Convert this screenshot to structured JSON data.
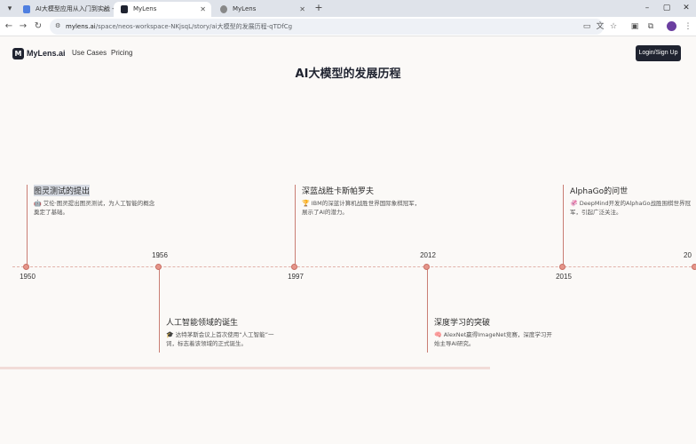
{
  "browser": {
    "tabs": [
      {
        "title": "AI大模型应用从入门到实战 - 飞...",
        "active": false
      },
      {
        "title": "MyLens",
        "active": true
      },
      {
        "title": "MyLens",
        "active": false
      }
    ],
    "url_host": "mylens.ai",
    "url_path": "/space/neos-workspace-NKjsqL/story/ai大模型的发展历程-qTDfCg"
  },
  "header": {
    "logo_text": "MyLens.ai",
    "logo_mark": "M",
    "nav": [
      "Use Cases",
      "Pricing"
    ],
    "login_label": "Login/Sign Up"
  },
  "page_title": "AI大模型的发展历程",
  "timeline": {
    "events": [
      {
        "year": "1950",
        "title": "图灵测试的提出",
        "emoji": "🤖",
        "desc": "艾伦·图灵提出图灵测试，为人工智能的概念奠定了基础。"
      },
      {
        "year": "1956",
        "title": "人工智能领域的诞生",
        "emoji": "🎓",
        "desc": "达特茅斯会议上首次使用“人工智能”一词，标志着该领域的正式诞生。"
      },
      {
        "year": "1997",
        "title": "深蓝战胜卡斯帕罗夫",
        "emoji": "🏆",
        "desc": "IBM的深蓝计算机战胜世界国际象棋冠军，展示了AI的潜力。"
      },
      {
        "year": "2012",
        "title": "深度学习的突破",
        "emoji": "🧠",
        "desc": "AlexNet赢得ImageNet竞赛，深度学习开始主导AI研究。"
      },
      {
        "year": "2015",
        "title": "AlphaGo的问世",
        "emoji": "🦑",
        "desc": "DeepMind开发的AlphaGo战胜围棋世界冠军，引起广泛关注。"
      },
      {
        "year": "20",
        "title": "",
        "emoji": "",
        "desc": ""
      }
    ]
  },
  "colors": {
    "accent": "#e5958a",
    "stem": "#c97e74",
    "dark": "#1f2330"
  }
}
